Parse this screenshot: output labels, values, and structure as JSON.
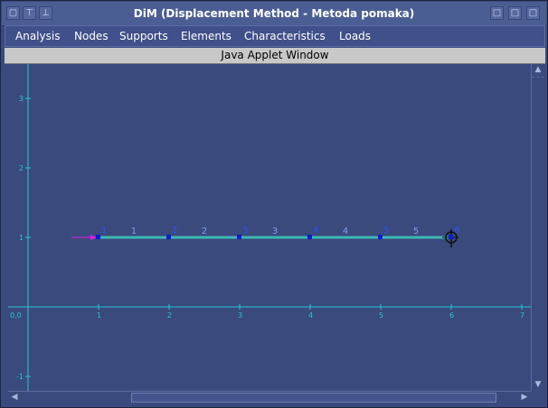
{
  "window": {
    "title": "DiM (Displacement Method - Metoda pomaka)",
    "title_buttons": [
      "▢",
      "⊤",
      "⊥"
    ],
    "right_buttons": [
      "□",
      "□",
      "□"
    ]
  },
  "menu": {
    "items": [
      "Analysis",
      "Nodes",
      "Supports",
      "Elements",
      "Characteristics",
      "Loads"
    ]
  },
  "applet": {
    "label": "Java Applet Window"
  },
  "chart_data": {
    "type": "line",
    "x_ticks": [
      "0,0",
      "1",
      "2",
      "3",
      "4",
      "5",
      "6",
      "7"
    ],
    "y_ticks": [
      "-1",
      "1",
      "2",
      "3"
    ],
    "xlim": [
      0,
      7
    ],
    "ylim": [
      -1,
      3
    ],
    "nodes": [
      {
        "id": "1",
        "x": 1,
        "y": 1
      },
      {
        "id": "2",
        "x": 2,
        "y": 1
      },
      {
        "id": "3",
        "x": 3,
        "y": 1
      },
      {
        "id": "4",
        "x": 4,
        "y": 1
      },
      {
        "id": "5",
        "x": 5,
        "y": 1
      },
      {
        "id": "6",
        "x": 6,
        "y": 1
      }
    ],
    "elements": [
      {
        "id": "1",
        "from": 1,
        "to": 2
      },
      {
        "id": "2",
        "from": 2,
        "to": 3
      },
      {
        "id": "3",
        "from": 3,
        "to": 4
      },
      {
        "id": "4",
        "from": 4,
        "to": 5
      },
      {
        "id": "5",
        "from": 5,
        "to": 6
      }
    ],
    "load": {
      "node": 1,
      "direction": "right"
    },
    "support": {
      "node": 6,
      "kind": "fixed"
    },
    "colors": {
      "axis": "#26c7d6",
      "element": "#3fb7b2",
      "node": "#0a1dd0",
      "label": "#2e4fff",
      "element_label": "#7f9cf0",
      "load": "#e020e0",
      "support": "#101010"
    }
  }
}
